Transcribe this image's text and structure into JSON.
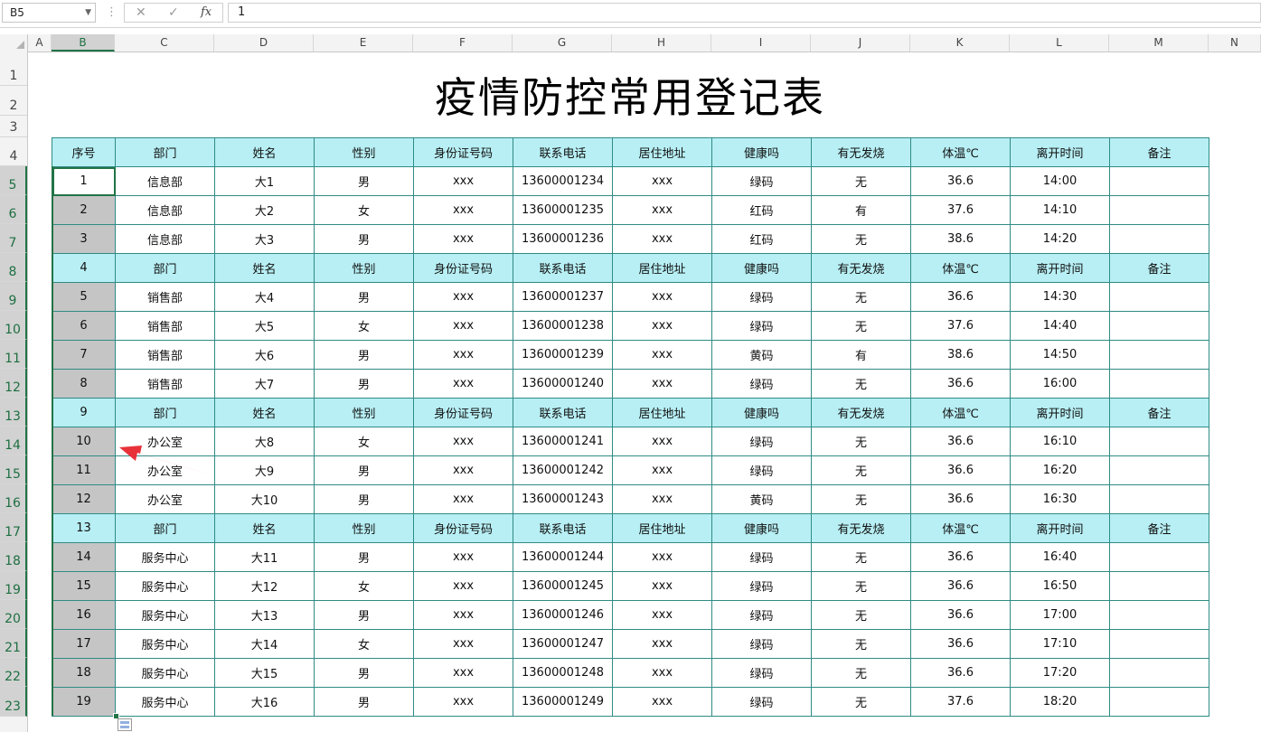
{
  "formula_bar": {
    "name_box": "B5",
    "cancel_icon": "✕",
    "enter_icon": "✓",
    "fx_label": "fx",
    "value": "1"
  },
  "columns": [
    "A",
    "B",
    "C",
    "D",
    "E",
    "F",
    "G",
    "H",
    "I",
    "J",
    "K",
    "L",
    "M",
    "N"
  ],
  "rows": [
    "1",
    "2",
    "3",
    "4",
    "5",
    "6",
    "7",
    "8",
    "9",
    "10",
    "11",
    "12",
    "13",
    "14",
    "15",
    "16",
    "17",
    "18",
    "19",
    "20",
    "21",
    "22",
    "23"
  ],
  "sheet": {
    "title": "疫情防控常用登记表",
    "header": [
      "序号",
      "部门",
      "姓名",
      "性别",
      "身份证号码",
      "联系电话",
      "居住地址",
      "健康吗",
      "有无发烧",
      "体温℃",
      "离开时间",
      "备注"
    ],
    "repeat_header": [
      "部门",
      "姓名",
      "性别",
      "身份证号码",
      "联系电话",
      "居住地址",
      "健康吗",
      "有无发烧",
      "体温℃",
      "离开时间",
      "备注"
    ],
    "rows": [
      {
        "type": "data",
        "cells": [
          "1",
          "信息部",
          "大1",
          "男",
          "xxx",
          "13600001234",
          "xxx",
          "绿码",
          "无",
          "36.6",
          "14:00",
          ""
        ]
      },
      {
        "type": "data",
        "cells": [
          "2",
          "信息部",
          "大2",
          "女",
          "xxx",
          "13600001235",
          "xxx",
          "红码",
          "有",
          "37.6",
          "14:10",
          ""
        ]
      },
      {
        "type": "data",
        "cells": [
          "3",
          "信息部",
          "大3",
          "男",
          "xxx",
          "13600001236",
          "xxx",
          "红码",
          "无",
          "38.6",
          "14:20",
          ""
        ]
      },
      {
        "type": "header",
        "cells": [
          "4",
          "部门",
          "姓名",
          "性别",
          "身份证号码",
          "联系电话",
          "居住地址",
          "健康吗",
          "有无发烧",
          "体温℃",
          "离开时间",
          "备注"
        ]
      },
      {
        "type": "data",
        "cells": [
          "5",
          "销售部",
          "大4",
          "男",
          "xxx",
          "13600001237",
          "xxx",
          "绿码",
          "无",
          "36.6",
          "14:30",
          ""
        ]
      },
      {
        "type": "data",
        "cells": [
          "6",
          "销售部",
          "大5",
          "女",
          "xxx",
          "13600001238",
          "xxx",
          "绿码",
          "无",
          "37.6",
          "14:40",
          ""
        ]
      },
      {
        "type": "data",
        "cells": [
          "7",
          "销售部",
          "大6",
          "男",
          "xxx",
          "13600001239",
          "xxx",
          "黄码",
          "有",
          "38.6",
          "14:50",
          ""
        ]
      },
      {
        "type": "data",
        "cells": [
          "8",
          "销售部",
          "大7",
          "男",
          "xxx",
          "13600001240",
          "xxx",
          "绿码",
          "无",
          "36.6",
          "16:00",
          ""
        ]
      },
      {
        "type": "header",
        "cells": [
          "9",
          "部门",
          "姓名",
          "性别",
          "身份证号码",
          "联系电话",
          "居住地址",
          "健康吗",
          "有无发烧",
          "体温℃",
          "离开时间",
          "备注"
        ]
      },
      {
        "type": "data",
        "cells": [
          "10",
          "办公室",
          "大8",
          "女",
          "xxx",
          "13600001241",
          "xxx",
          "绿码",
          "无",
          "36.6",
          "16:10",
          ""
        ]
      },
      {
        "type": "data",
        "cells": [
          "11",
          "办公室",
          "大9",
          "男",
          "xxx",
          "13600001242",
          "xxx",
          "绿码",
          "无",
          "36.6",
          "16:20",
          ""
        ]
      },
      {
        "type": "data",
        "cells": [
          "12",
          "办公室",
          "大10",
          "男",
          "xxx",
          "13600001243",
          "xxx",
          "黄码",
          "无",
          "36.6",
          "16:30",
          ""
        ]
      },
      {
        "type": "header",
        "cells": [
          "13",
          "部门",
          "姓名",
          "性别",
          "身份证号码",
          "联系电话",
          "居住地址",
          "健康吗",
          "有无发烧",
          "体温℃",
          "离开时间",
          "备注"
        ]
      },
      {
        "type": "data",
        "cells": [
          "14",
          "服务中心",
          "大11",
          "男",
          "xxx",
          "13600001244",
          "xxx",
          "绿码",
          "无",
          "36.6",
          "16:40",
          ""
        ]
      },
      {
        "type": "data",
        "cells": [
          "15",
          "服务中心",
          "大12",
          "女",
          "xxx",
          "13600001245",
          "xxx",
          "绿码",
          "无",
          "36.6",
          "16:50",
          ""
        ]
      },
      {
        "type": "data",
        "cells": [
          "16",
          "服务中心",
          "大13",
          "男",
          "xxx",
          "13600001246",
          "xxx",
          "绿码",
          "无",
          "36.6",
          "17:00",
          ""
        ]
      },
      {
        "type": "data",
        "cells": [
          "17",
          "服务中心",
          "大14",
          "女",
          "xxx",
          "13600001247",
          "xxx",
          "绿码",
          "无",
          "36.6",
          "17:10",
          ""
        ]
      },
      {
        "type": "data",
        "cells": [
          "18",
          "服务中心",
          "大15",
          "男",
          "xxx",
          "13600001248",
          "xxx",
          "绿码",
          "无",
          "36.6",
          "17:20",
          ""
        ]
      },
      {
        "type": "data",
        "cells": [
          "19",
          "服务中心",
          "大16",
          "男",
          "xxx",
          "13600001249",
          "xxx",
          "绿码",
          "无",
          "37.6",
          "18:20",
          ""
        ]
      }
    ]
  },
  "colors": {
    "header_fill": "#b7eff4",
    "border": "#2f8b85",
    "selection": "#217346",
    "selected_fill": "#c5c5c5",
    "annotation_arrow": "#e8323a"
  }
}
